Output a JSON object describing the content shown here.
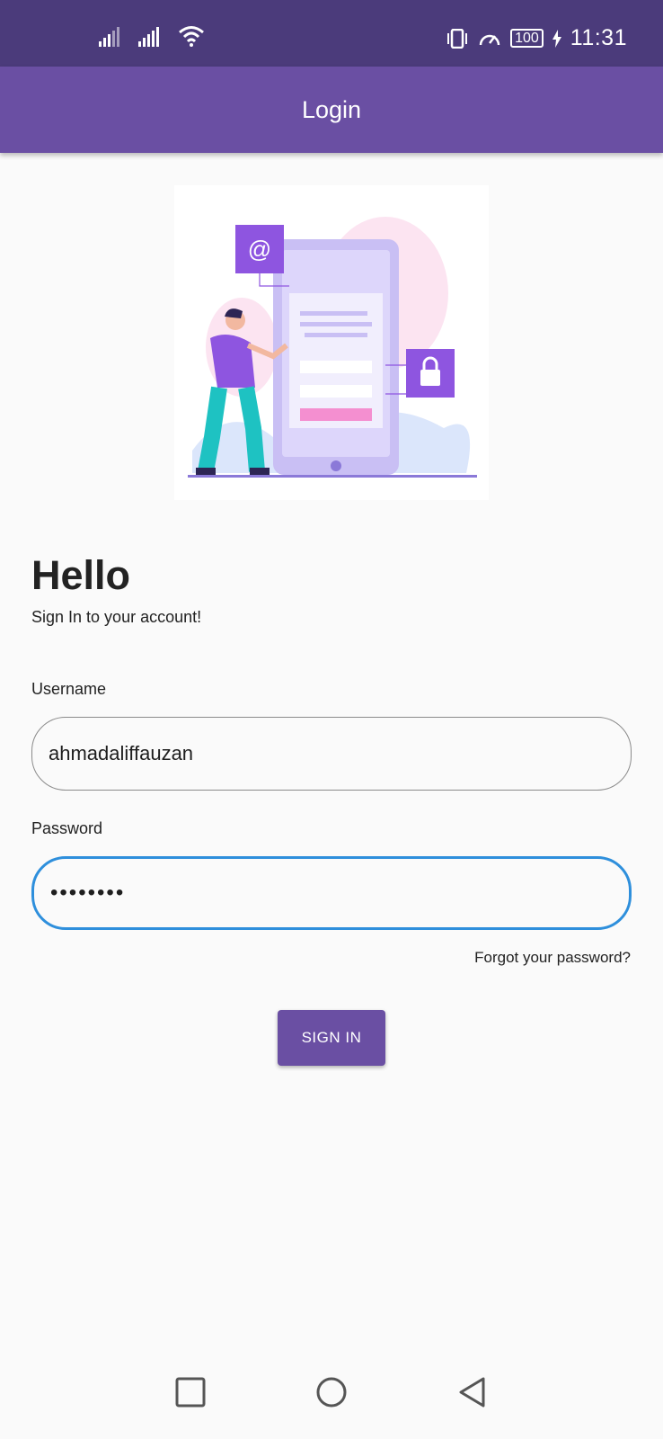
{
  "status_bar": {
    "time": "11:31",
    "battery": "100",
    "icons": [
      "signal-icon",
      "signal-icon",
      "wifi-icon",
      "vibrate-icon",
      "speed-icon",
      "battery-icon",
      "charging-icon"
    ]
  },
  "app_bar": {
    "title": "Login"
  },
  "hero": {
    "illustration": "login-illustration"
  },
  "form": {
    "greeting": "Hello",
    "subtitle": "Sign In to your account!",
    "username_label": "Username",
    "username_value": "ahmadaliffauzan",
    "password_label": "Password",
    "password_value": "••••••••",
    "forgot_label": "Forgot your password?",
    "signin_label": "SIGN IN"
  },
  "nav": {
    "icons": [
      "recent-apps-icon",
      "home-icon",
      "back-icon"
    ]
  },
  "colors": {
    "primary": "#6a4fa3",
    "status_bar": "#4b3b7b",
    "focus": "#2e8fdc"
  }
}
